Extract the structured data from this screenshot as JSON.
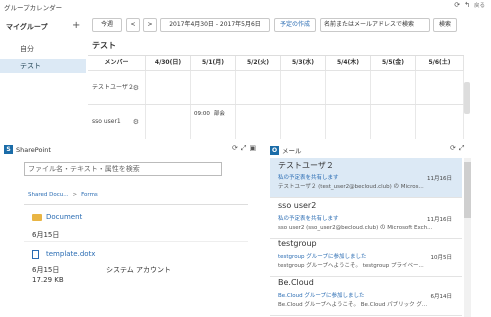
{
  "calendar": {
    "title": "グループカレンダー",
    "tools": {
      "refresh": "⟳",
      "back_icon": "↰",
      "back": "戻る"
    },
    "sidebar": {
      "heading": "マイグループ",
      "add": "+",
      "items": [
        {
          "label": "自分"
        },
        {
          "label": "テスト"
        }
      ]
    },
    "toolbar": {
      "today": "今週",
      "prev": "<",
      "next": ">",
      "range": "2017年4月30日 - 2017年5月6日",
      "create": "予定の作成",
      "search_placeholder": "名前またはメールアドレスで検索",
      "search": "検索"
    },
    "group_name": "テスト",
    "columns": [
      "メンバー",
      "4/30(日)",
      "5/1(月)",
      "5/2(火)",
      "5/3(水)",
      "5/4(木)",
      "5/5(金)",
      "5/6(土)"
    ],
    "members": [
      {
        "name": "テストユーザ２",
        "gear": "⚙"
      },
      {
        "name": "sso user1",
        "gear": "⚙",
        "event_time": "09:00",
        "event_title": "部会"
      }
    ]
  },
  "sharepoint": {
    "title": "SharePoint",
    "tools": {
      "refresh": "⟳",
      "expand": "⤢",
      "menu": "▣"
    },
    "search_placeholder": "ファイル名・テキスト・属性を検索",
    "breadcrumb": [
      "Shared Docu...",
      "Forms"
    ],
    "breadcrumb_sep": ">",
    "items": [
      {
        "name": "Document",
        "date": "6月15日"
      },
      {
        "name": "template.dotx",
        "date": "6月15日",
        "owner": "システム アカウント",
        "size": "17.29 KB"
      }
    ]
  },
  "mail": {
    "title": "メール",
    "tools": {
      "refresh": "⟳",
      "expand": "⤢"
    },
    "items": [
      {
        "from": "テストユーザ２",
        "subject": "私の予定表を共有します",
        "date": "11月16日",
        "preview": "テストユーザ２ (test_user2@becloud.club) の Micros..."
      },
      {
        "from": "sso user2",
        "subject": "私の予定表を共有します",
        "date": "11月16日",
        "preview": "sso user2 (sso_user2@becloud.club) の Microsoft Exch..."
      },
      {
        "from": "testgroup",
        "subject": "testgroup グループに参加しました",
        "date": "10月5日",
        "preview": "testgroup グループへようこそ。 testgroup プライベー..."
      },
      {
        "from": "Be.Cloud",
        "subject": "Be.Cloud グループに参加しました",
        "date": "6月14日",
        "preview": "Be.Cloud グループへようこそ。 Be.Cloud パブリック グ..."
      }
    ]
  }
}
